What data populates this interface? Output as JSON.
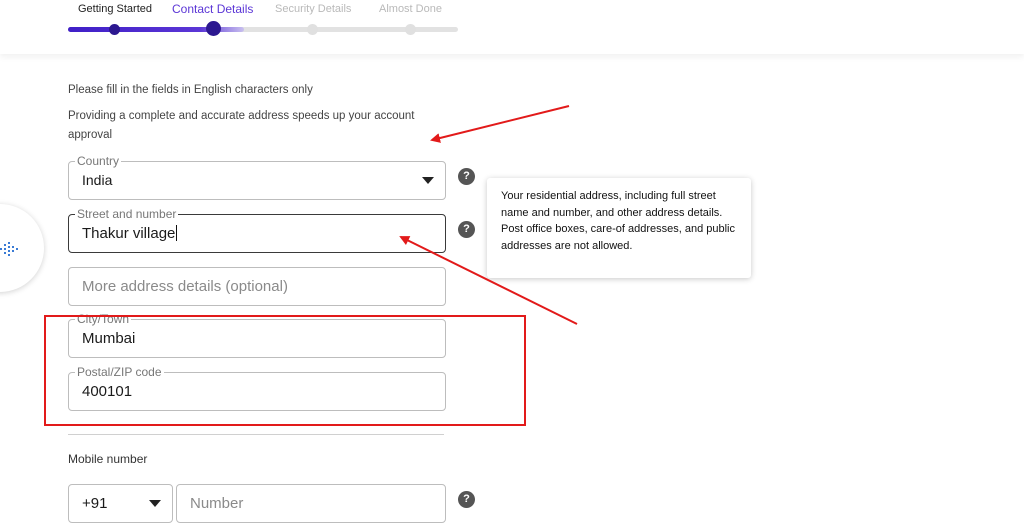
{
  "steps": {
    "items": [
      {
        "label": "Getting Started"
      },
      {
        "label": "Contact Details"
      },
      {
        "label": "Security Details"
      },
      {
        "label": "Almost Done"
      }
    ],
    "active_index": 1,
    "progress_fraction": 0.45
  },
  "notes": {
    "english_only": "Please fill in the fields in English characters only",
    "address_speed": "Providing a complete and accurate address speeds up your account approval"
  },
  "form": {
    "country": {
      "label": "Country",
      "value": "India"
    },
    "street": {
      "label": "Street and number",
      "value": "Thakur village"
    },
    "more_address": {
      "placeholder": "More address details (optional)"
    },
    "city": {
      "label": "City/Town",
      "value": "Mumbai"
    },
    "postal": {
      "label": "Postal/ZIP code",
      "value": "400101"
    },
    "mobile": {
      "label": "Mobile number",
      "country_code": "+91",
      "number_placeholder": "Number"
    }
  },
  "help_glyph": "?",
  "tooltip": {
    "text": "Your residential address, including full street name and number, and other address details. Post office boxes, care-of addresses, and public addresses are not allowed."
  },
  "colors": {
    "accent": "#5b36d6",
    "progress_dark": "#2c1890",
    "annotation_red": "#e21a1a"
  },
  "icons": {
    "help": "question-circle-icon",
    "dropdown": "chevron-down-icon",
    "side_widget": "dotted-grid-icon"
  }
}
